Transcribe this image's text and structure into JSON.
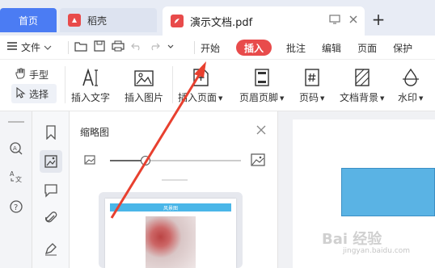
{
  "tabs": {
    "home": "首页",
    "daoke": "稻壳",
    "document": "演示文档.pdf",
    "new_tab": "+"
  },
  "menu": {
    "file": "文件",
    "tabs": [
      "开始",
      "插入",
      "批注",
      "编辑",
      "页面",
      "保护"
    ],
    "active_tab": "插入"
  },
  "ribbon": {
    "hand": "手型",
    "select": "选择",
    "insert_text": "插入文字",
    "insert_image": "插入图片",
    "insert_page": "插入页面",
    "header_footer": "页眉页脚",
    "page_number": "页码",
    "background": "文档背景",
    "watermark": "水印"
  },
  "thumbnail": {
    "title": "缩略图",
    "page_header": "风景图"
  },
  "watermark": {
    "text": "Bai 经验",
    "sub": "jingyan.baidu.com"
  },
  "colors": {
    "home_tab": "#4b7cf3",
    "active_menu": "#e84b4b",
    "annotation_arrow": "#e8402f",
    "shape_fill": "#5ab3e4"
  }
}
